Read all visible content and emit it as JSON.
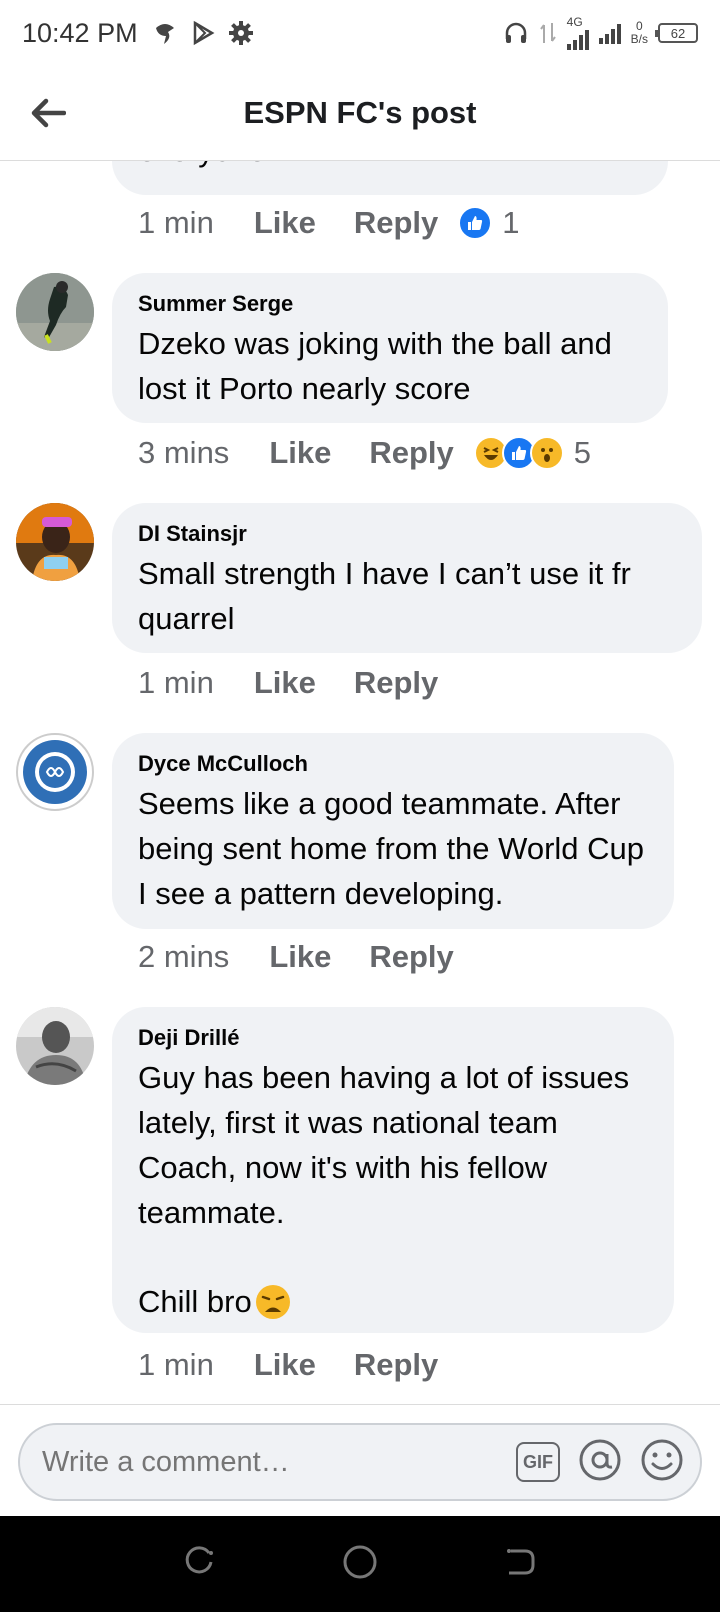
{
  "status_bar": {
    "time": "10:42 PM",
    "network": "4G",
    "data_speed_value": "0",
    "data_speed_unit": "B/s",
    "battery": "62"
  },
  "header": {
    "title": "ESPN FC's post"
  },
  "partial_comment": {
    "text_tail": "everyone",
    "time": "1 min",
    "like_label": "Like",
    "reply_label": "Reply",
    "reaction_count": "1"
  },
  "comments": [
    {
      "author": "Summer Serge",
      "text": "Dzeko was joking with the ball and lost it Porto nearly score",
      "time": "3 mins",
      "like_label": "Like",
      "reply_label": "Reply",
      "reaction_count": "5"
    },
    {
      "author": "DI Stainsjr",
      "text": "Small strength I have I can’t use it fr quarrel",
      "time": "1 min",
      "like_label": "Like",
      "reply_label": "Reply"
    },
    {
      "author": "Dyce McCulloch",
      "text": "Seems like a good teammate. After being sent home from the World Cup I see a pattern developing.",
      "time": "2 mins",
      "like_label": "Like",
      "reply_label": "Reply"
    },
    {
      "author": "Deji Drillé",
      "text_line1": "Guy has been having a lot of issues lately, first it was national team Coach, now it's with his fellow teammate.",
      "text_line2": "Chill bro",
      "time": "1 min",
      "like_label": "Like",
      "reply_label": "Reply"
    }
  ],
  "composer": {
    "placeholder": "Write a comment…",
    "gif_label": "GIF"
  },
  "colors": {
    "bubble": "#f0f2f5",
    "like_blue": "#1877f2",
    "meta_gray": "#65676b",
    "haha_yellow": "#f7b928"
  },
  "icons": [
    "back-arrow-icon",
    "like-reaction-icon",
    "haha-reaction-icon",
    "wow-reaction-icon",
    "gif-icon",
    "mention-icon",
    "emoji-icon"
  ]
}
